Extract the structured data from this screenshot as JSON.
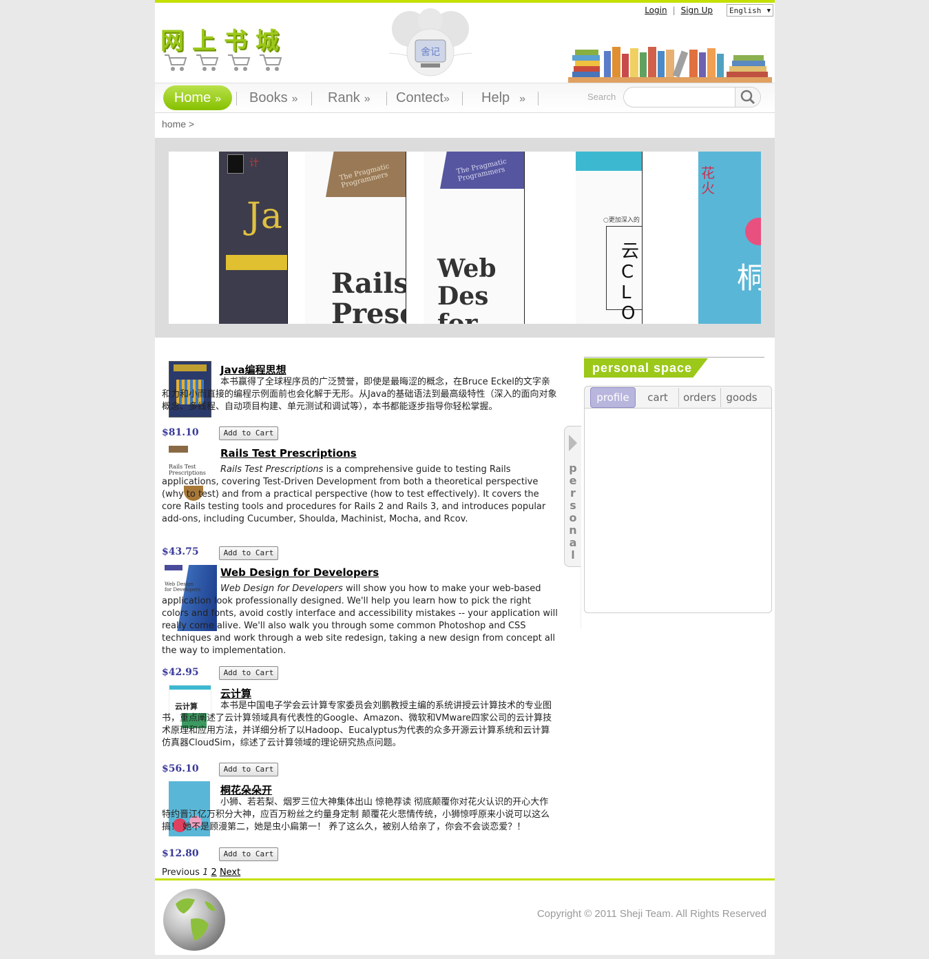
{
  "header": {
    "login": "Login",
    "signup": "Sign Up",
    "separator": "|",
    "language": "English",
    "logo_text": "网上书城",
    "mascot_text": "舍记"
  },
  "nav": {
    "items": [
      {
        "label": "Home",
        "suffix": "»"
      },
      {
        "label": "Books",
        "suffix": "»"
      },
      {
        "label": "Rank",
        "suffix": "»"
      },
      {
        "label": "Contect",
        "suffix": "»"
      },
      {
        "label": "Help",
        "suffix": "»"
      }
    ],
    "search_label": "Search",
    "search_placeholder": ""
  },
  "breadcrumb": "home >",
  "carousel": {
    "slides": [
      {
        "text": "Ja",
        "sub": "计"
      },
      {
        "text": "Rails Presc",
        "sub": "The Pragmatic Programmers"
      },
      {
        "text": "Web Des for",
        "sub": "The Pragmatic Programmers"
      },
      {
        "text": "云 CLO",
        "sub": "○更加深入的"
      },
      {
        "text": "桐",
        "sub": "花火"
      }
    ]
  },
  "books": [
    {
      "title": "Java编程思想",
      "desc": "本书赢得了全球程序员的广泛赞誉，即使是最晦涩的概念，在Bruce Eckel的文字亲和力和小而直接的编程示例面前也会化解于无形。从Java的基础语法到最高级特性（深入的面向对象概念、多线程、自动项目构建、单元测试和调试等），本书都能逐步指导你轻松掌握。",
      "price": "$81.10",
      "button": "Add to Cart"
    },
    {
      "title": "Rails Test Prescriptions",
      "desc_em": "Rails Test Prescriptions",
      "desc": " is a comprehensive guide to testing Rails applications, covering Test-Driven Development from both a theoretical perspective (why to test) and from a practical perspective (how to test effectively). It covers the core Rails testing tools and procedures for Rails 2 and Rails 3, and introduces popular add-ons, including Cucumber, Shoulda, Machinist, Mocha, and Rcov.",
      "price": "$43.75",
      "button": "Add to Cart"
    },
    {
      "title": "Web Design for Developers",
      "desc_em": "Web Design for Developers",
      "desc": " will show you how to make your web-based application look professionally designed. We'll help you learn how to pick the right colors and fonts, avoid costly interface and accessibility mistakes -- your application will really come alive. We'll also walk you through some common Photoshop and CSS techniques and work through a web site redesign, taking a new design from concept all the way to implementation.",
      "price": "$42.95",
      "button": "Add to Cart"
    },
    {
      "title": "云计算",
      "desc": "本书是中国电子学会云计算专家委员会刘鹏教授主编的系统讲授云计算技术的专业图书，重点阐述了云计算领域具有代表性的Google、Amazon、微软和VMware四家公司的云计算技术原理和应用方法，并详细分析了以Hadoop、Eucalyptus为代表的众多开源云计算系统和云计算仿真器CloudSim，综述了云计算领域的理论研究热点问题。",
      "price": "$56.10",
      "button": "Add to Cart"
    },
    {
      "title": "桐花朵朵开",
      "desc": "小狮、若若梨、烟罗三位大神集体出山 惊艳荐读 彻底颠覆你对花火认识的开心大作 特约晋江亿万积分大神，应百万粉丝之约量身定制 颠覆花火悲情传统，小狮惊呼原来小说可以这么搞！ 她不是顾漫第二，她是虫小扁第一！ 养了这么久，被别人给亲了，你会不会谈恋爱？！",
      "price": "$12.80",
      "button": "Add to Cart"
    }
  ],
  "pager": {
    "prev": "Previous",
    "p1": "1",
    "p2": "2",
    "next": "Next"
  },
  "personal": {
    "tab_label": "personal",
    "title": "personal space",
    "tabs": [
      "profile",
      "cart",
      "orders",
      "goods"
    ]
  },
  "footer": {
    "copyright": "Copyright © 2011 Sheji Team. All Rights Reserved"
  },
  "colors": {
    "accent": "#c3e000",
    "green": "#9cc81a",
    "price": "#3a3a9a",
    "tab_active": "#b9b6de"
  }
}
